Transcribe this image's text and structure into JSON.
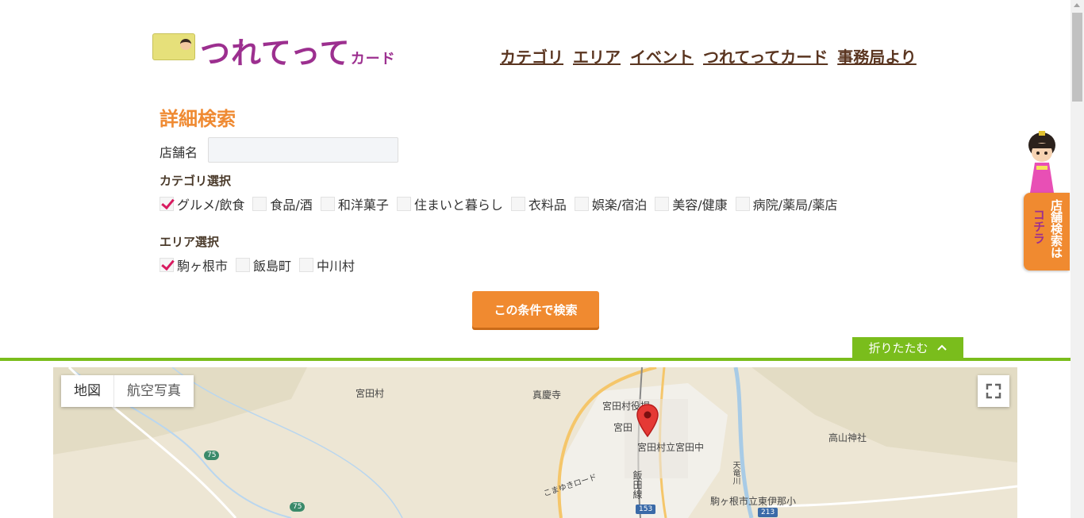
{
  "header": {
    "logo_text": "つれてって",
    "logo_sub": "カード",
    "nav": [
      "カテゴリ",
      "エリア",
      "イベント",
      "つれてってカード",
      "事務局より"
    ]
  },
  "search": {
    "title": "詳細検索",
    "store_name_label": "店舗名",
    "store_name_value": "",
    "category_title": "カテゴリ選択",
    "categories": [
      {
        "label": "グルメ/飲食",
        "checked": true
      },
      {
        "label": "食品/酒",
        "checked": false
      },
      {
        "label": "和洋菓子",
        "checked": false
      },
      {
        "label": "住まいと暮らし",
        "checked": false
      },
      {
        "label": "衣料品",
        "checked": false
      },
      {
        "label": "娯楽/宿泊",
        "checked": false
      },
      {
        "label": "美容/健康",
        "checked": false
      },
      {
        "label": "病院/薬局/薬店",
        "checked": false
      }
    ],
    "area_title": "エリア選択",
    "areas": [
      {
        "label": "駒ヶ根市",
        "checked": true
      },
      {
        "label": "飯島町",
        "checked": false
      },
      {
        "label": "中川村",
        "checked": false
      }
    ],
    "submit": "この条件で検索",
    "fold": "折りたたむ"
  },
  "map": {
    "type_map": "地図",
    "type_satellite": "航空写真",
    "labels": {
      "miyadamura": "宮田村",
      "shinkeiji": "真慶寺",
      "village_office": "宮田村役場",
      "miyada_station": "宮田",
      "miyada_jhs": "宮田村立宮田中",
      "takayama_shrine": "高山神社",
      "iida_line": "飯田線",
      "komayuki_road": "こまゆきロード",
      "tenryu_river": "天竜川",
      "higashiina_es": "駒ヶ根市立東伊那小",
      "route_75a": "75",
      "route_75b": "75",
      "route_153": "153",
      "route_213": "213"
    }
  },
  "side": {
    "tab_main": "店舗検索は",
    "tab_sub": "コチラ"
  }
}
